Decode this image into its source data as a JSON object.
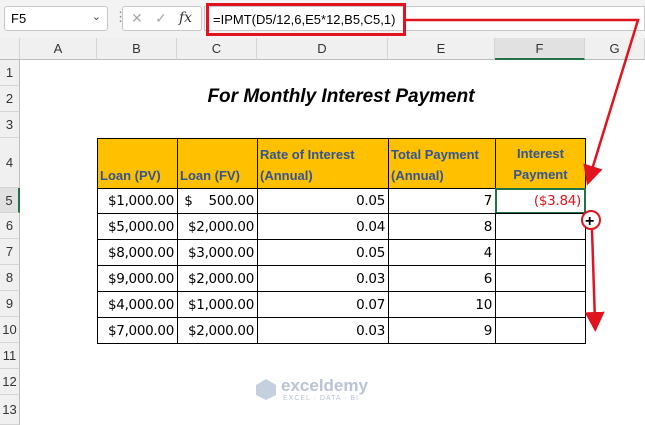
{
  "name_box": "F5",
  "formula_bar": {
    "cancel_icon": "✕",
    "enter_icon": "✓",
    "fx_label": "fx",
    "formula": "=IPMT(D5/12,6,E5*12,B5,C5,1)"
  },
  "columns": [
    "A",
    "B",
    "C",
    "D",
    "E",
    "F",
    "G"
  ],
  "rows": [
    "1",
    "2",
    "3",
    "4",
    "5",
    "6",
    "7",
    "8",
    "9",
    "10",
    "11",
    "12",
    "13"
  ],
  "title": "For Monthly Interest Payment",
  "table": {
    "headers": [
      "Loan (PV)",
      "Loan (FV)",
      "Rate of Interest (Annual)",
      "Total Payment (Annual)",
      "Interest Payment"
    ],
    "rows": [
      [
        "$1,000.00",
        "$    500.00",
        "0.05",
        "7",
        "($3.84)"
      ],
      [
        "$5,000.00",
        "$2,000.00",
        "0.04",
        "8",
        ""
      ],
      [
        "$8,000.00",
        "$3,000.00",
        "0.05",
        "4",
        ""
      ],
      [
        "$9,000.00",
        "$2,000.00",
        "0.03",
        "6",
        ""
      ],
      [
        "$4,000.00",
        "$1,000.00",
        "0.07",
        "10",
        ""
      ],
      [
        "$7,000.00",
        "$2,000.00",
        "0.03",
        "9",
        ""
      ]
    ]
  },
  "watermark": {
    "brand": "exceldemy",
    "tagline": "EXCEL · DATA · BI"
  },
  "colors": {
    "header_fill": "#ffc000",
    "header_text": "#305496",
    "annotation": "#e0141e",
    "selection": "#217346"
  }
}
